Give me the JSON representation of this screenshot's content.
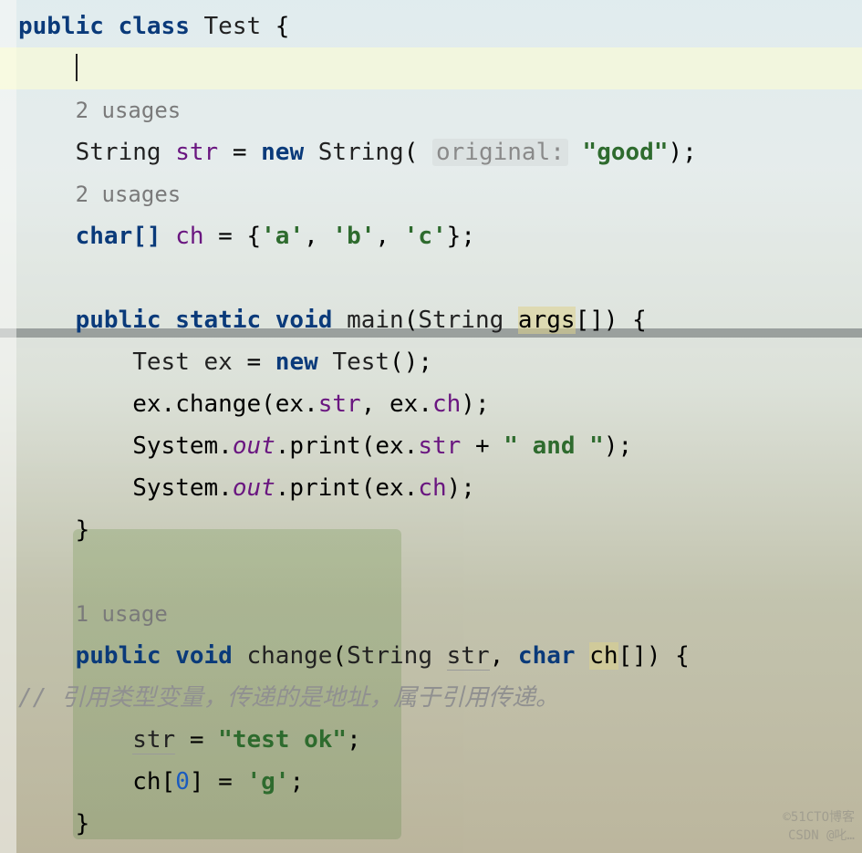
{
  "kw": {
    "public": "public",
    "class": "class",
    "new": "new",
    "char": "char",
    "void": "void",
    "static": "static"
  },
  "className": "Test",
  "usages2": "2 usages",
  "usage1": "1 usage",
  "line3": {
    "type": "String",
    "field": "str",
    "eq": " = ",
    "newkw": "new",
    "ctor": "String",
    "hintLabel": "original:",
    "value": "\"good\""
  },
  "line5": {
    "type": "char[]",
    "field": "ch",
    "eq": " = {",
    "a": "'a'",
    "b": "'b'",
    "c": "'c'"
  },
  "main": {
    "sig1": "public static void",
    "name": "main",
    "paramType": "String",
    "paramName": "args",
    "body": {
      "declType": "Test",
      "declVar": "ex",
      "newkw": "new",
      "ctor": "Test",
      "l1a": "ex.change(ex.",
      "l1f1": "str",
      "l1b": ", ex.",
      "l1f2": "ch",
      "l1c": ");",
      "sysout": "System.",
      "out": "out",
      "printa": ".print(ex.",
      "printStr": "str",
      "plus": " + ",
      "andStr": "\" and \"",
      "close": ");",
      "printCh": "ch"
    }
  },
  "change": {
    "sig": "public void",
    "name": "change",
    "p1t": "String",
    "p1n": "str",
    "p2t": "char",
    "p2n": "ch",
    "comment": "// 引用类型变量，传递的是地址，属于引用传递。",
    "assignVar": "str",
    "assignEq": " = ",
    "assignVal": "\"test ok\"",
    "chAssignA": "ch[",
    "chIndex": "0",
    "chAssignB": "] = ",
    "chVal": "'g'"
  },
  "watermark1": "©51CTO博客",
  "watermark2": "CSDN @叱…"
}
